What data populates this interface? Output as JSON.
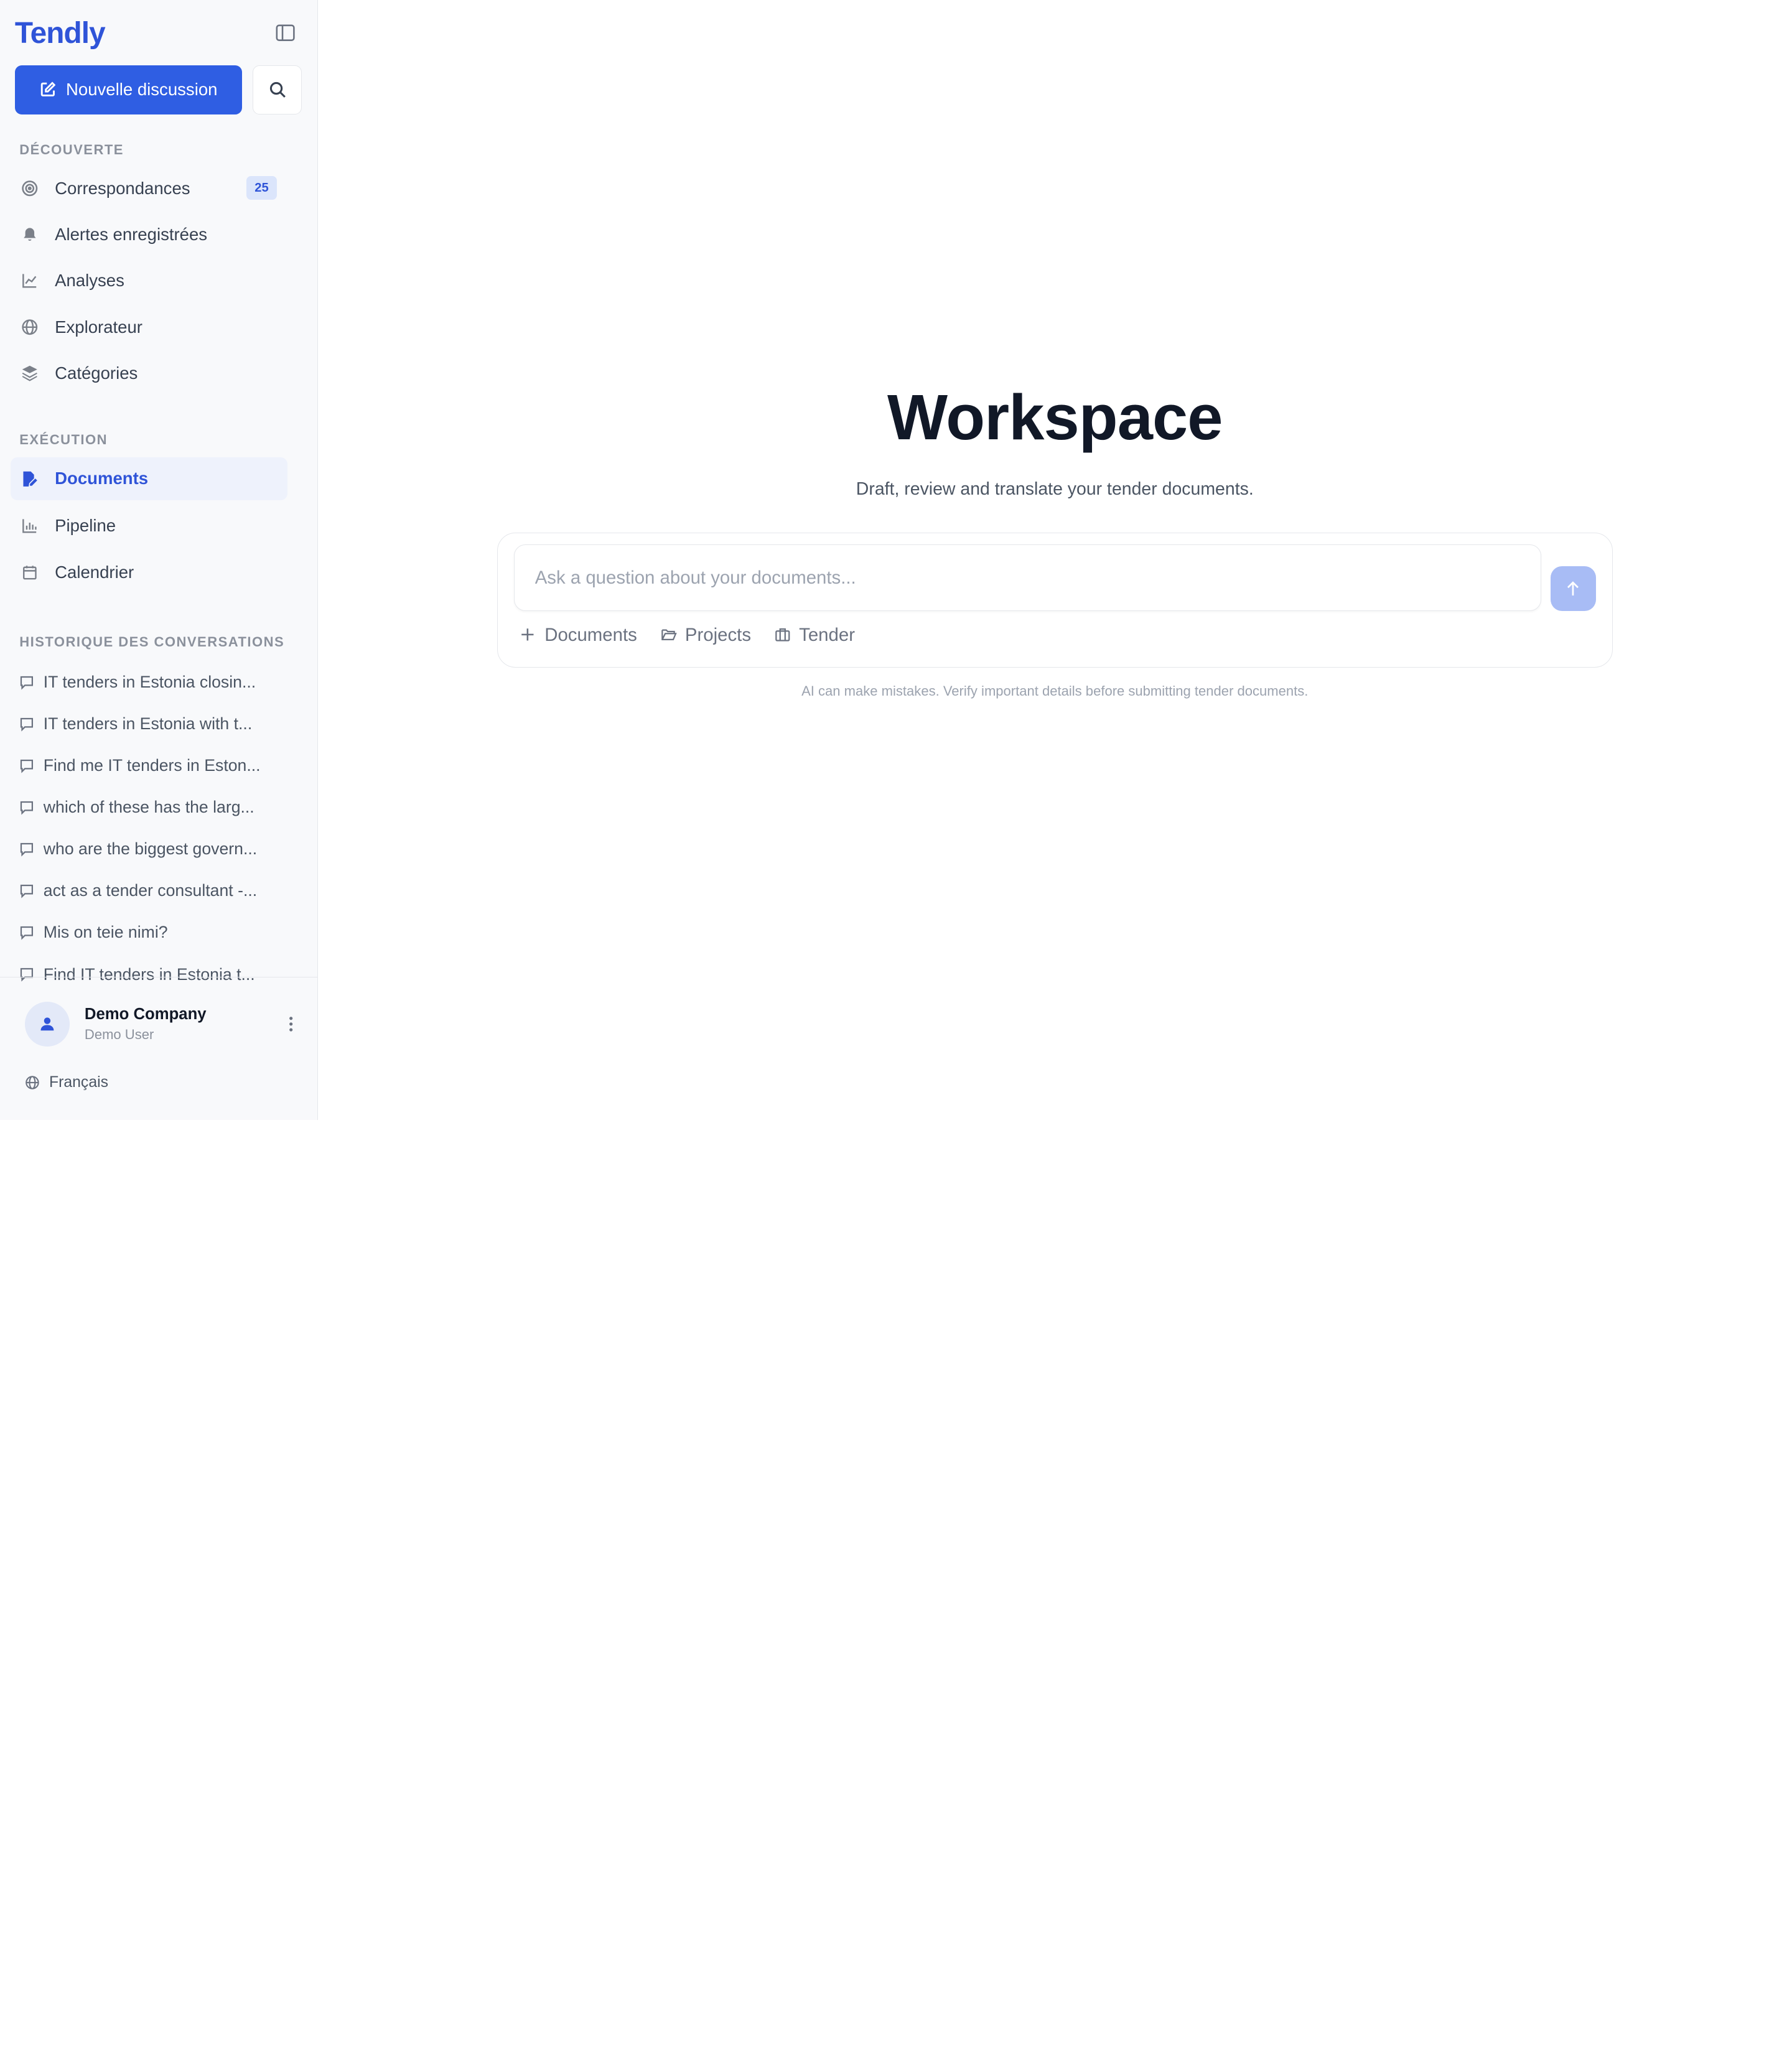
{
  "brand": {
    "name": "Tendly"
  },
  "actions": {
    "new_chat_label": "Nouvelle discussion"
  },
  "sections": {
    "discovery": "DÉCOUVERTE",
    "execution": "EXÉCUTION",
    "history": "HISTORIQUE DES CONVERSATIONS"
  },
  "discovery_items": [
    {
      "label": "Correspondances",
      "icon": "target-icon",
      "badge": "25"
    },
    {
      "label": "Alertes enregistrées",
      "icon": "bell-icon"
    },
    {
      "label": "Analyses",
      "icon": "line-chart-icon"
    },
    {
      "label": "Explorateur",
      "icon": "globe-icon"
    },
    {
      "label": "Catégories",
      "icon": "layers-icon"
    }
  ],
  "execution_items": [
    {
      "label": "Documents",
      "icon": "file-edit-icon",
      "active": true
    },
    {
      "label": "Pipeline",
      "icon": "bar-chart-icon"
    },
    {
      "label": "Calendrier",
      "icon": "calendar-icon"
    }
  ],
  "history": [
    "IT tenders in Estonia closin...",
    "IT tenders in Estonia with t...",
    "Find me IT tenders in Eston...",
    "which of these has the larg...",
    "who are the biggest govern...",
    "act as a tender consultant -...",
    "Mis on teie nimi?",
    "Find IT tenders in Estonia t..."
  ],
  "user": {
    "company": "Demo Company",
    "name": "Demo User"
  },
  "language": "Français",
  "main": {
    "title": "Workspace",
    "subtitle": "Draft, review and translate your tender documents.",
    "input_placeholder": "Ask a question about your documents...",
    "tools": {
      "documents": "Documents",
      "projects": "Projects",
      "tender": "Tender"
    },
    "disclaimer": "AI can make mistakes. Verify important details before submitting tender documents."
  },
  "colors": {
    "accent": "#2f5ee3",
    "brand": "#2f54d8",
    "send_disabled": "#a8bcf5"
  }
}
